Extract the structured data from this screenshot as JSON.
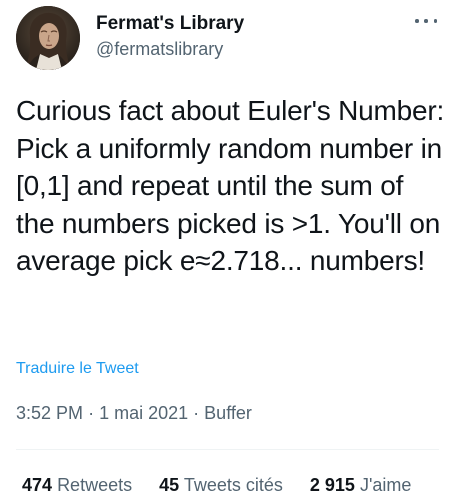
{
  "user": {
    "display_name": "Fermat's Library",
    "handle": "@fermatslibrary"
  },
  "tweet": {
    "text": "Curious fact about Euler's Number: Pick a uniformly random number in [0,1] and repeat until the sum of the numbers picked is >1. You'll on average pick e≈2.718... numbers!",
    "translate_label": "Traduire le Tweet",
    "time": "3:52 PM",
    "date": "1 mai 2021",
    "source": "Buffer",
    "separator": "·"
  },
  "stats": [
    {
      "count": "474",
      "label": "Retweets"
    },
    {
      "count": "45",
      "label": "Tweets cités"
    },
    {
      "count": "2 915",
      "label": "J'aime"
    }
  ],
  "icons": {
    "more": "more-horizontal-icon",
    "avatar": "avatar-portrait"
  },
  "colors": {
    "text": "#0f1419",
    "secondary": "#536471",
    "link": "#1d9bf0",
    "divider": "#eff3f4"
  }
}
